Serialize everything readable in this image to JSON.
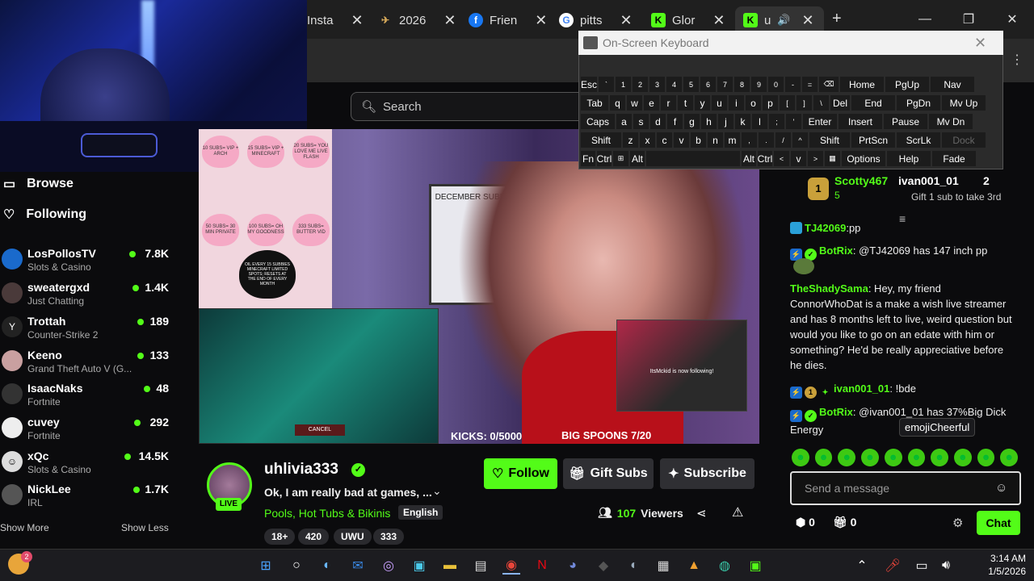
{
  "tabs": [
    {
      "label": "Insta",
      "icon": "instagram-icon"
    },
    {
      "label": "2026",
      "icon": "plane-icon"
    },
    {
      "label": "Frien",
      "icon": "facebook-icon"
    },
    {
      "label": "pitts",
      "icon": "google-icon"
    },
    {
      "label": "Glor",
      "icon": "kick-icon"
    },
    {
      "label": "u",
      "icon": "kick-icon",
      "active": true
    }
  ],
  "page": {
    "search_placeholder": "Search"
  },
  "osk": {
    "title": "On-Screen Keyboard",
    "rows": [
      [
        "Esc",
        "`",
        "1",
        "2",
        "3",
        "4",
        "5",
        "6",
        "7",
        "8",
        "9",
        "0",
        "-",
        "=",
        "⌫",
        "Home",
        "PgUp",
        "Nav"
      ],
      [
        "Tab",
        "q",
        "w",
        "e",
        "r",
        "t",
        "y",
        "u",
        "i",
        "o",
        "p",
        "[",
        "]",
        "\\",
        "Del",
        "End",
        "PgDn",
        "Mv Up"
      ],
      [
        "Caps",
        "a",
        "s",
        "d",
        "f",
        "g",
        "h",
        "j",
        "k",
        "l",
        ";",
        "'",
        "Enter",
        "Insert",
        "Pause",
        "Mv Dn"
      ],
      [
        "Shift",
        "z",
        "x",
        "c",
        "v",
        "b",
        "n",
        "m",
        ",",
        ".",
        "/",
        "^",
        "Shift",
        "PrtScn",
        "ScrLk",
        "Dock"
      ],
      [
        "Fn",
        "Ctrl",
        "⊞",
        "Alt",
        "",
        "Alt",
        "Ctrl",
        "<",
        "v",
        ">",
        "▦",
        "Options",
        "Help",
        "Fade"
      ]
    ]
  },
  "sidebar": {
    "browse": "Browse",
    "following": "Following",
    "channels": [
      {
        "name": "LosPollosTV",
        "category": "Slots & Casino",
        "viewers": "7.8K"
      },
      {
        "name": "sweatergxd",
        "category": "Just Chatting",
        "viewers": "1.4K"
      },
      {
        "name": "Trottah",
        "category": "Counter-Strike 2",
        "viewers": "189"
      },
      {
        "name": "Keeno",
        "category": "Grand Theft Auto V (G...",
        "viewers": "133"
      },
      {
        "name": "IsaacNaks",
        "category": "Fortnite",
        "viewers": "48"
      },
      {
        "name": "cuvey",
        "category": "Fortnite",
        "viewers": "292"
      },
      {
        "name": "xQc",
        "category": "Slots & Casino",
        "viewers": "14.5K"
      },
      {
        "name": "NickLee",
        "category": "IRL",
        "viewers": "1.7K"
      }
    ],
    "show_more": "Show More",
    "show_less": "Show Less"
  },
  "video": {
    "kicks": "KICKS: 0/5000",
    "spoons": "BIG SPOONS 7/20",
    "whiteboard": "DECEMBER SUBBIES",
    "game_cancel": "CANCEL",
    "clip_text": "ItsMckid is now following!",
    "hearts": [
      "10 SUBS= VIP + ARCH",
      "15 SUBS= VIP + MINECRAFT",
      "20 SUBS= YOU LOVE ME LIVE FLASH",
      "50 SUBS= 30 MIN PRIVATE",
      "100 SUBS= OH MY GOODNESS",
      "333 SUBS= BUTTER VID"
    ],
    "black_heart": "OIL EVERY 15 SUBBIES MINECRAFT LIMITED SPOTS; RESETS AT THE END OF EVERY MONTH"
  },
  "stream": {
    "username": "uhlivia333",
    "live": "LIVE",
    "title": "Ok, I am really bad at games, ...",
    "category": "Pools, Hot Tubs & Bikinis",
    "language": "English",
    "tags": [
      "18+",
      "420",
      "UWU",
      "333"
    ],
    "follow": "Follow",
    "gift": "Gift Subs",
    "subscribe": "Subscribe",
    "viewers_count": "107",
    "viewers_label": "Viewers"
  },
  "chat": {
    "top_user": "Scotty467",
    "top_count": "5",
    "top_user2": "ivan001_01",
    "top_count2": "2",
    "gift_text": "Gift 1 sub to take 3rd",
    "messages": [
      {
        "user": "TJ42069",
        "text": ":pp",
        "color": "#53fc18"
      },
      {
        "user": "BotRix",
        "text": ": @TJ42069 has 147 inch pp",
        "color": "#53fc18"
      },
      {
        "user": "TheShadySama",
        "text": ": Hey, my friend ConnorWhoDat is a make a wish live streamer and has 8 months left to live, weird question but would you like to go on an edate with him or something? He'd be really appreciative before he dies.",
        "color": "#53fc18"
      },
      {
        "user": "ivan001_01",
        "text": ": !bde",
        "color": "#53fc18"
      },
      {
        "user": "BotRix",
        "text": ": @ivan001_01 has 37%Big Dick Energy",
        "color": "#53fc18"
      }
    ],
    "tooltip": "emojiCheerful",
    "placeholder": "Send a message",
    "footer_a": "0",
    "footer_b": "0",
    "send": "Chat"
  },
  "taskbar": {
    "time": "3:14 AM",
    "date": "1/5/2026",
    "notif_count": "2"
  },
  "colors": {
    "accent": "#53fc18",
    "background": "#0b0b0d"
  }
}
